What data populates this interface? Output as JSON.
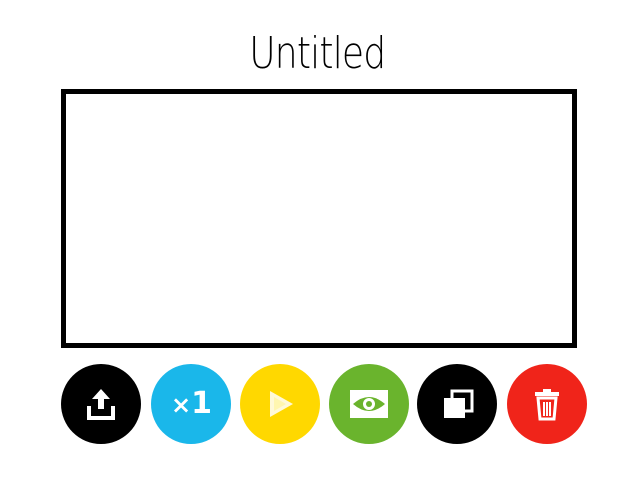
{
  "project": {
    "title": "Untitled"
  },
  "toolbar": {
    "speed_prefix": "×",
    "speed_value": "1",
    "buttons": [
      {
        "icon": "upload-icon",
        "color": "#000000"
      },
      {
        "icon": "speed-icon",
        "color": "#1ab7ea"
      },
      {
        "icon": "play-icon",
        "color": "#ffd800"
      },
      {
        "icon": "eye-icon",
        "color": "#6ab42d"
      },
      {
        "icon": "copy-icon",
        "color": "#000000"
      },
      {
        "icon": "trash-icon",
        "color": "#f0241a"
      }
    ]
  }
}
